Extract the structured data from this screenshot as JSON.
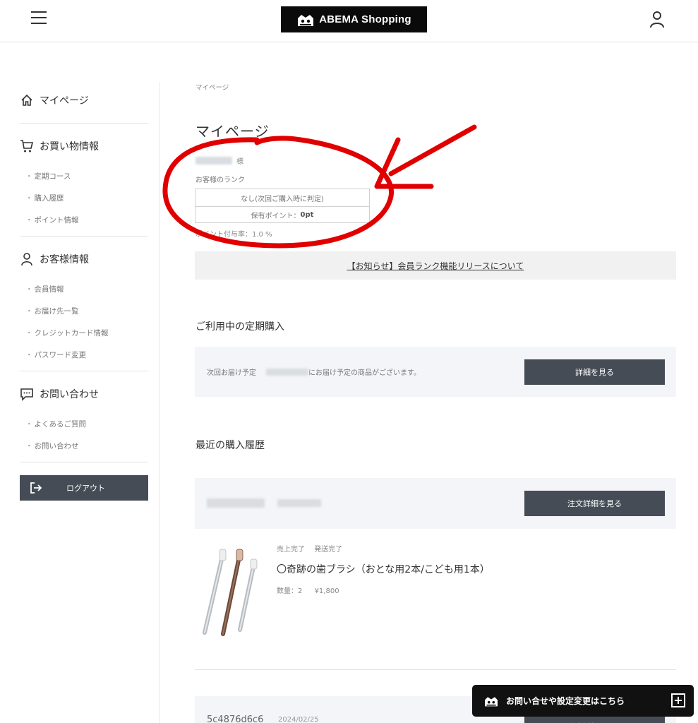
{
  "header": {
    "logo_text": "ABEMA Shopping"
  },
  "breadcrumb": "マイページ",
  "page_title": "マイページ",
  "member": {
    "name_suffix": "様",
    "rank_label": "お客様のランク",
    "rank_value": "なし(次回ご購入時に判定)",
    "points_label": "保有ポイント：",
    "points_value": "0pt",
    "points_rate": "ポイント付与率：1.0 %"
  },
  "notice": "【お知らせ】会員ランク機能リリースについて",
  "sidebar": {
    "mypage": "マイページ",
    "shopping_head": "お買い物情報",
    "shopping_items": [
      "定期コース",
      "購入履歴",
      "ポイント情報"
    ],
    "customer_head": "お客様情報",
    "customer_items": [
      "会員情報",
      "お届け先一覧",
      "クレジットカード情報",
      "パスワード変更"
    ],
    "contact_head": "お問い合わせ",
    "contact_items": [
      "よくあるご質問",
      "お問い合わせ"
    ],
    "logout": "ログアウト"
  },
  "subscription": {
    "title": "ご利用中の定期購入",
    "next_label": "次回お届け予定",
    "next_text": "にお届け予定の商品がございます。",
    "detail_button": "詳細を見る"
  },
  "history": {
    "title": "最近の購入履歴",
    "order_button": "注文詳細を見る",
    "status_sale": "売上完了",
    "status_ship": "発送完了",
    "product_name": "〇奇跡の歯ブラシ（おとな用2本/こども用1本）",
    "quantity": "数量：2",
    "price": "¥1,800",
    "order2_id": "5c4876d6c6",
    "order2_date": "2024/02/25"
  },
  "float_help": "お問い合せや設定変更はこちら",
  "colors": {
    "dark_button": "#454c55",
    "panel_bg": "#f3f5f8",
    "annotation": "#e00000"
  }
}
